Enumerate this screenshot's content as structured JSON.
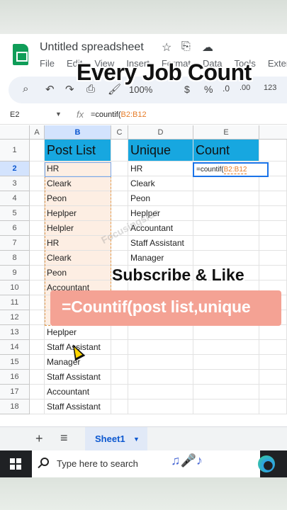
{
  "app": {
    "title": "Untitled spreadsheet",
    "menu": [
      "File",
      "Edit",
      "View",
      "Insert",
      "Format",
      "Data",
      "Tools",
      "Extens"
    ]
  },
  "overlay": {
    "headline": "Every Job Count",
    "subscribe": "Subscribe & Like",
    "tip": "=Countif(post list,unique",
    "watermark": "Focusingside"
  },
  "toolbar": {
    "zoom": "100%",
    "currency": "$",
    "percent": "%",
    "decimals_less": ".0",
    "decimals_more": ".00",
    "number_format": "123"
  },
  "formula_bar": {
    "cell_ref": "E2",
    "fx": "fx",
    "formula_prefix": "=countif(",
    "formula_range": "B2:B12"
  },
  "columns": [
    "A",
    "B",
    "C",
    "D",
    "E"
  ],
  "rows": [
    {
      "n": "1",
      "b": "Post List",
      "d": "Unique",
      "e": "Count"
    },
    {
      "n": "2",
      "b": "HR",
      "d": "HR",
      "e": ""
    },
    {
      "n": "3",
      "b": "Cleark",
      "d": "Cleark",
      "e": ""
    },
    {
      "n": "4",
      "b": "Peon",
      "d": "Peon",
      "e": ""
    },
    {
      "n": "5",
      "b": "Heplper",
      "d": "Heplper",
      "e": ""
    },
    {
      "n": "6",
      "b": "Helpler",
      "d": "Accountant",
      "e": ""
    },
    {
      "n": "7",
      "b": "HR",
      "d": "Staff Assistant",
      "e": ""
    },
    {
      "n": "8",
      "b": "Cleark",
      "d": "Manager",
      "e": ""
    },
    {
      "n": "9",
      "b": "Peon",
      "d": "",
      "e": ""
    },
    {
      "n": "10",
      "b": "Accountant",
      "d": "",
      "e": ""
    },
    {
      "n": "11",
      "b": "",
      "d": "",
      "e": ""
    },
    {
      "n": "12",
      "b": "",
      "d": "",
      "e": ""
    },
    {
      "n": "13",
      "b": "Heplper",
      "d": "",
      "e": ""
    },
    {
      "n": "14",
      "b": "Staff Assistant",
      "d": "",
      "e": ""
    },
    {
      "n": "15",
      "b": "Manager",
      "d": "",
      "e": ""
    },
    {
      "n": "16",
      "b": "Staff Assistant",
      "d": "",
      "e": ""
    },
    {
      "n": "17",
      "b": "Accountant",
      "d": "",
      "e": ""
    },
    {
      "n": "18",
      "b": "Staff Assistant",
      "d": "",
      "e": ""
    }
  ],
  "active_cell": {
    "prefix": "=countif(",
    "range": "B2:B12"
  },
  "sheets": {
    "add": "+",
    "all": "≡",
    "active_tab": "Sheet1"
  },
  "taskbar": {
    "search_placeholder": "Type here to search",
    "deco": "♫🎤♪"
  },
  "colors": {
    "header_fill": "#17a7e0",
    "range_fill": "#fdeee3",
    "tip_fill": "#f4a294",
    "accent": "#1a73e8"
  }
}
